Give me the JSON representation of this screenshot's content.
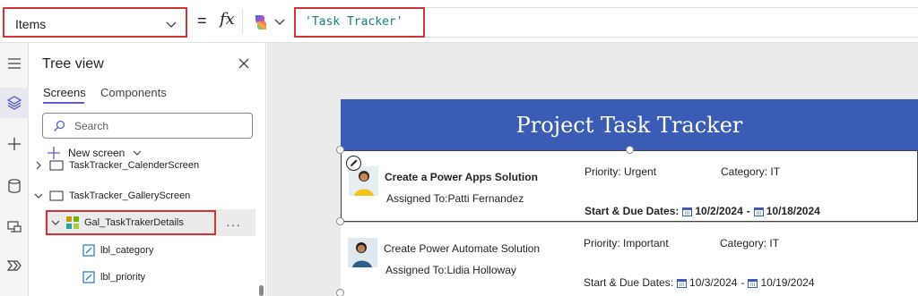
{
  "formula_bar": {
    "property": "Items",
    "equals": "=",
    "fx": "fx",
    "formula": "'Task Tracker'"
  },
  "rail": {
    "icons": [
      "hamburger-icon",
      "layers-icon",
      "plus-icon",
      "database-icon",
      "media-icon",
      "power-automate-icon"
    ]
  },
  "tree": {
    "title": "Tree view",
    "tabs": [
      "Screens",
      "Components"
    ],
    "search_placeholder": "Search",
    "new_screen_label": "New screen",
    "nodes": [
      {
        "label": "TaskTracker_CalenderScreen"
      },
      {
        "label": "TaskTracker_GalleryScreen"
      },
      {
        "label": "Gal_TaskTrakerDetails"
      },
      {
        "label": "lbl_category"
      },
      {
        "label": "lbl_priority"
      }
    ],
    "more_label": "···"
  },
  "app": {
    "header_title": "Project Task Tracker",
    "items": [
      {
        "title": "Create a Power Apps Solution",
        "assigned": "Assigned To:Patti Fernandez",
        "priority": "Priority: Urgent",
        "category": "Category: IT",
        "dates_label": "Start & Due Dates:",
        "start_date": "10/2/2024",
        "separator": "-",
        "due_date": "10/18/2024"
      },
      {
        "title": "Create Power Automate Solution",
        "assigned": "Assigned To:Lidia Holloway",
        "priority": "Priority: Important",
        "category": "Category: IT",
        "dates_label": "Start & Due Dates:",
        "start_date": "10/3/2024",
        "separator": "-",
        "due_date": "10/19/2024"
      }
    ]
  },
  "colors": {
    "header_bg": "#3b5cb4",
    "highlight_red": "#d13438",
    "accent": "#5b5fc7",
    "formula_text": "#1a7d7d"
  }
}
